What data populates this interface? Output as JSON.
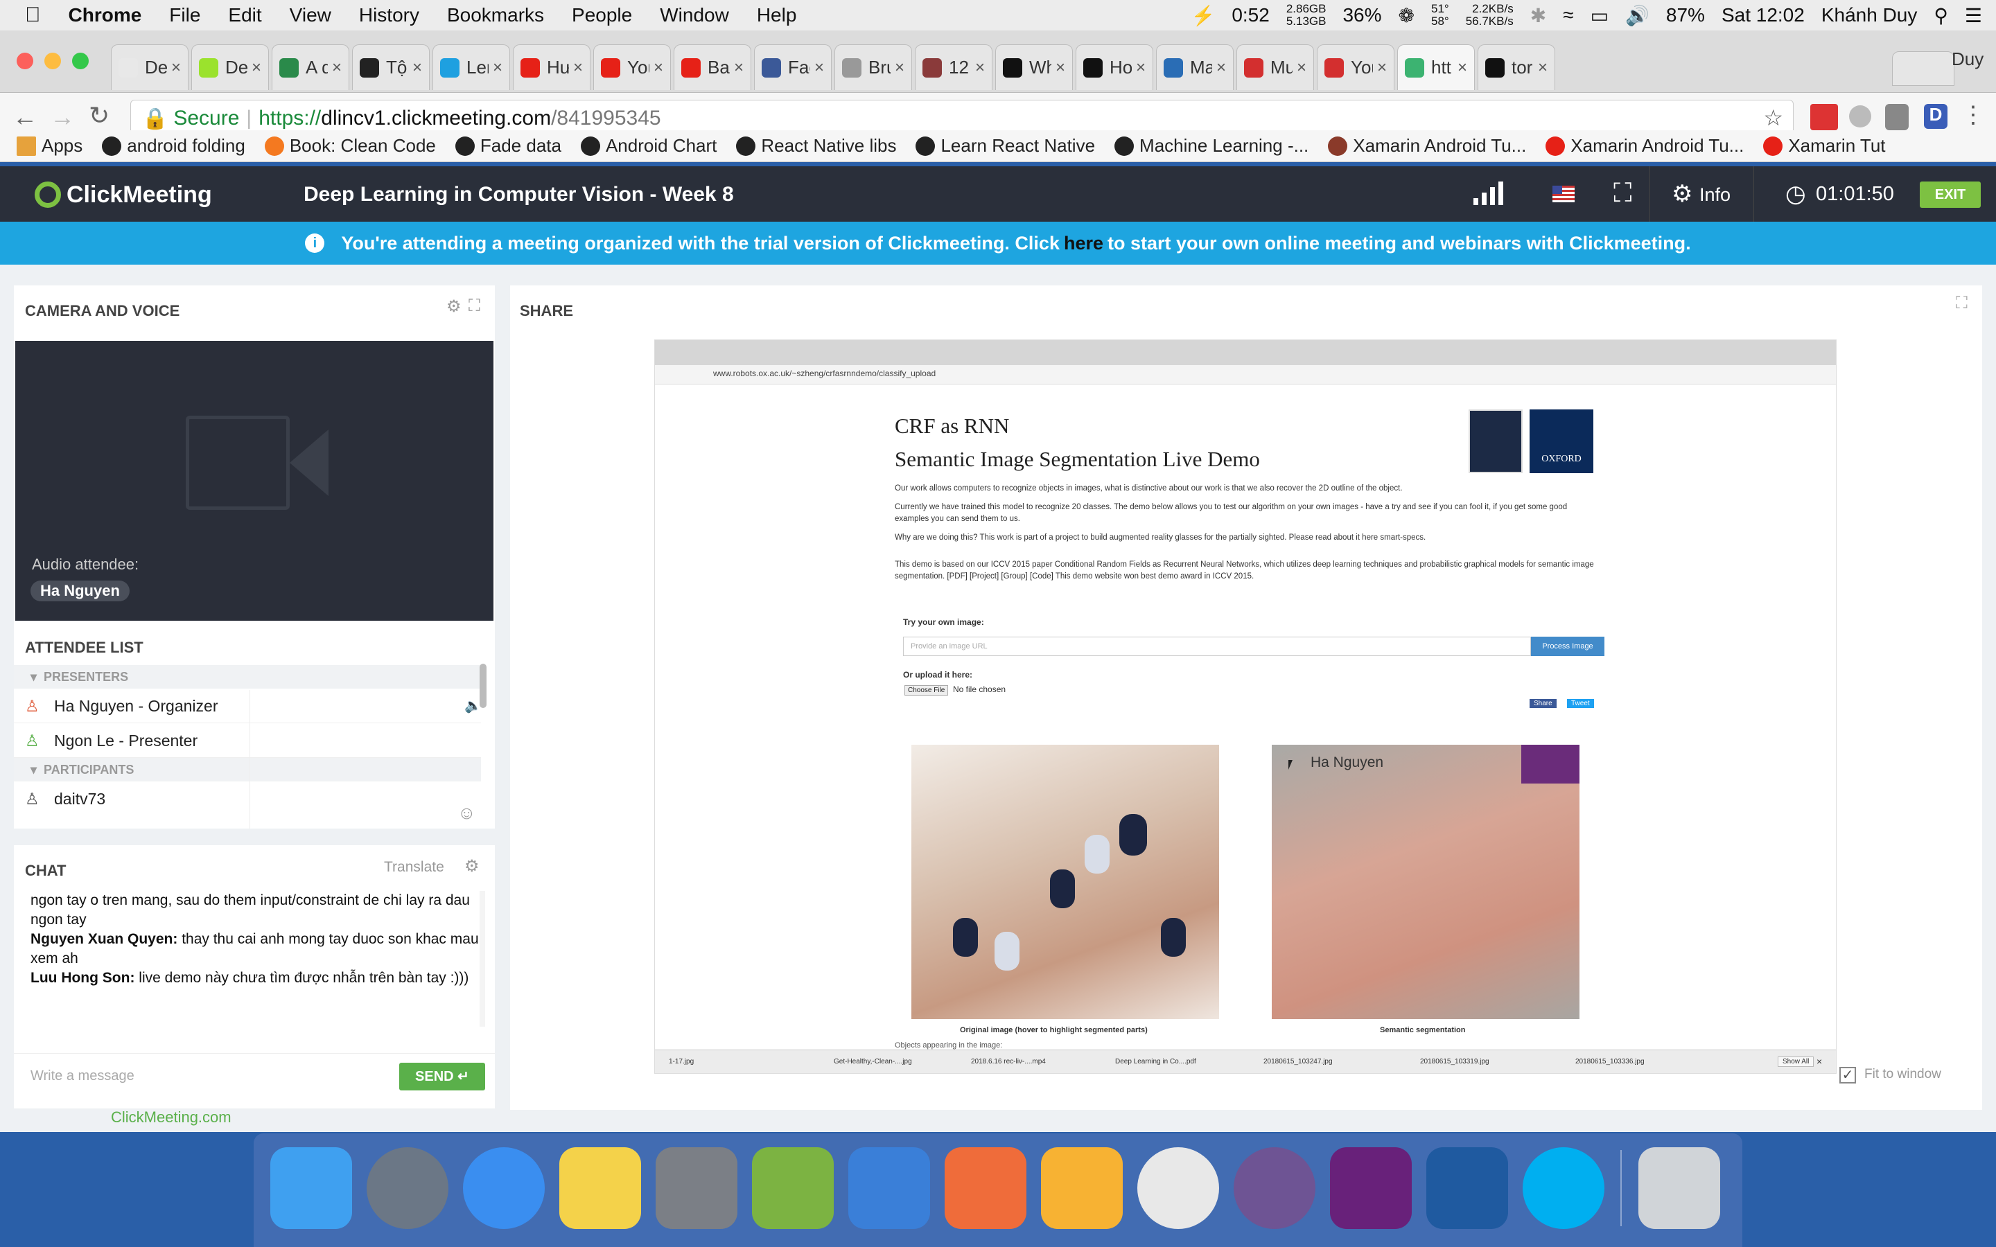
{
  "menubar": {
    "items": [
      "Chrome",
      "File",
      "Edit",
      "View",
      "History",
      "Bookmarks",
      "People",
      "Window",
      "Help"
    ],
    "battery_time": "0:52",
    "mem": "2.86GB",
    "mem2": "5.13GB",
    "cpu": "36%",
    "temp1": "51°",
    "temp2": "58°",
    "net_up": "2.2KB/s",
    "net_down": "56.7KB/s",
    "battery": "87%",
    "clock": "Sat 12:02",
    "user": "Khánh Duy"
  },
  "tabs": [
    {
      "label": "Dee",
      "color": "#e8e8e8"
    },
    {
      "label": "Dee",
      "color": "#9be22d"
    },
    {
      "label": "A d",
      "color": "#2a8a4a"
    },
    {
      "label": "Tội",
      "color": "#222"
    },
    {
      "label": "Ler",
      "color": "#1ea0e0"
    },
    {
      "label": "Hướ",
      "color": "#e62117"
    },
    {
      "label": "You",
      "color": "#e62117"
    },
    {
      "label": "Bac",
      "color": "#e62117"
    },
    {
      "label": "Fac",
      "color": "#3b5998"
    },
    {
      "label": "Bru",
      "color": "#999"
    },
    {
      "label": "12",
      "color": "#8a3a3a"
    },
    {
      "label": "Wh",
      "color": "#111"
    },
    {
      "label": "Ho",
      "color": "#111"
    },
    {
      "label": "Ma",
      "color": "#2a6db5"
    },
    {
      "label": "Mu",
      "color": "#d32f2f"
    },
    {
      "label": "You",
      "color": "#d32f2f"
    },
    {
      "label": "htt",
      "color": "#3cb371"
    },
    {
      "label": "torr",
      "color": "#111"
    }
  ],
  "profile_name": "Duy",
  "address": {
    "secure": "Secure",
    "url_prefix": "https://",
    "url_host": "dlincv1.clickmeeting.com",
    "url_path": "/841995345"
  },
  "bookmarks": [
    "Apps",
    "android folding",
    "Book: Clean Code",
    "Fade data",
    "Android Chart",
    "React Native libs",
    "Learn React Native",
    "Machine Learning -...",
    "Xamarin Android Tu...",
    "Xamarin Android Tu...",
    "Xamarin Tut"
  ],
  "app": {
    "logo": "ClickMeeting",
    "title": "Deep Learning in Computer Vision - Week 8",
    "info": "Info",
    "timer": "01:01:50",
    "exit": "EXIT"
  },
  "infobar": {
    "before": "You're attending a meeting organized with the trial version of Clickmeeting. Click ",
    "link": "here",
    "after": " to start your own online meeting and webinars with Clickmeeting."
  },
  "camera": {
    "title": "CAMERA AND VOICE",
    "audio_label": "Audio attendee:",
    "audio_name": "Ha Nguyen"
  },
  "attendees": {
    "title": "ATTENDEE LIST",
    "presenters_label": "PRESENTERS",
    "presenters": [
      "Ha Nguyen - Organizer",
      "Ngon Le - Presenter"
    ],
    "participants_label": "PARTICIPANTS",
    "participants": [
      "daitv73"
    ]
  },
  "chat": {
    "title": "CHAT",
    "translate": "Translate",
    "messages": [
      {
        "author": "",
        "text": "ngon tay o tren mang, sau do them input/constraint de chi lay ra dau ngon tay"
      },
      {
        "author": "Nguyen Xuan Quyen:",
        "text": " thay thu cai anh mong tay duoc son khac mau xem ah"
      },
      {
        "author": "Luu Hong Son:",
        "text": " live demo này chưa tìm được nhẫn trên bàn tay :)))"
      }
    ],
    "placeholder": "Write a message",
    "send": "SEND"
  },
  "share": {
    "title": "SHARE",
    "fit": "Fit to window",
    "inner_url": "www.robots.ox.ac.uk/~szheng/crfasrnndemo/classify_upload",
    "page_title1": "CRF as RNN",
    "page_title2": "Semantic Image Segmentation Live Demo",
    "oxford": "OXFORD",
    "para1": "Our work allows computers to recognize objects in images, what is distinctive about our work is that we also recover the 2D outline of the object.",
    "para2": "Currently we have trained this model to recognize 20 classes. The demo below allows you to test our algorithm on your own images - have a try and see if you can fool it, if you get some good examples you can send them to us.",
    "para3": "Why are we doing this? This work is part of a project to build augmented reality glasses for the partially sighted. Please read about it here smart-specs.",
    "para4": "This demo is based on our ICCV 2015 paper Conditional Random Fields as Recurrent Neural Networks, which utilizes deep learning techniques and probabilistic graphical models for semantic image segmentation. [PDF] [Project] [Group] [Code] This demo website won best demo award in ICCV 2015.",
    "try": "Try your own image:",
    "url_placeholder": "Provide an image URL",
    "process": "Process Image",
    "or_upload": "Or upload it here:",
    "choose": "Choose File",
    "nofile": "No file chosen",
    "fb_share": "Share",
    "tweet": "Tweet",
    "cap1": "Original image (hover to highlight segmented parts)",
    "cap2": "Semantic segmentation",
    "cursor_label": "Ha Nguyen",
    "objects": "Objects appearing in the image:",
    "downloads": [
      "1-17.jpg",
      "Get-Healthy,-Clean-....jpg",
      "2018.6.16 rec-liv-....mp4",
      "Deep Learning in Co....pdf",
      "20180615_103247.jpg",
      "20180615_103319.jpg",
      "20180615_103336.jpg"
    ],
    "show_all": "Show All"
  },
  "footer": {
    "powered": "ClickMeeting.com"
  },
  "dock": [
    "finder",
    "launchpad",
    "itunes",
    "notes",
    "system-preferences",
    "android-studio",
    "xcode",
    "postman",
    "sketch",
    "chrome",
    "github",
    "visual-studio",
    "vscode",
    "skype",
    "trash"
  ]
}
